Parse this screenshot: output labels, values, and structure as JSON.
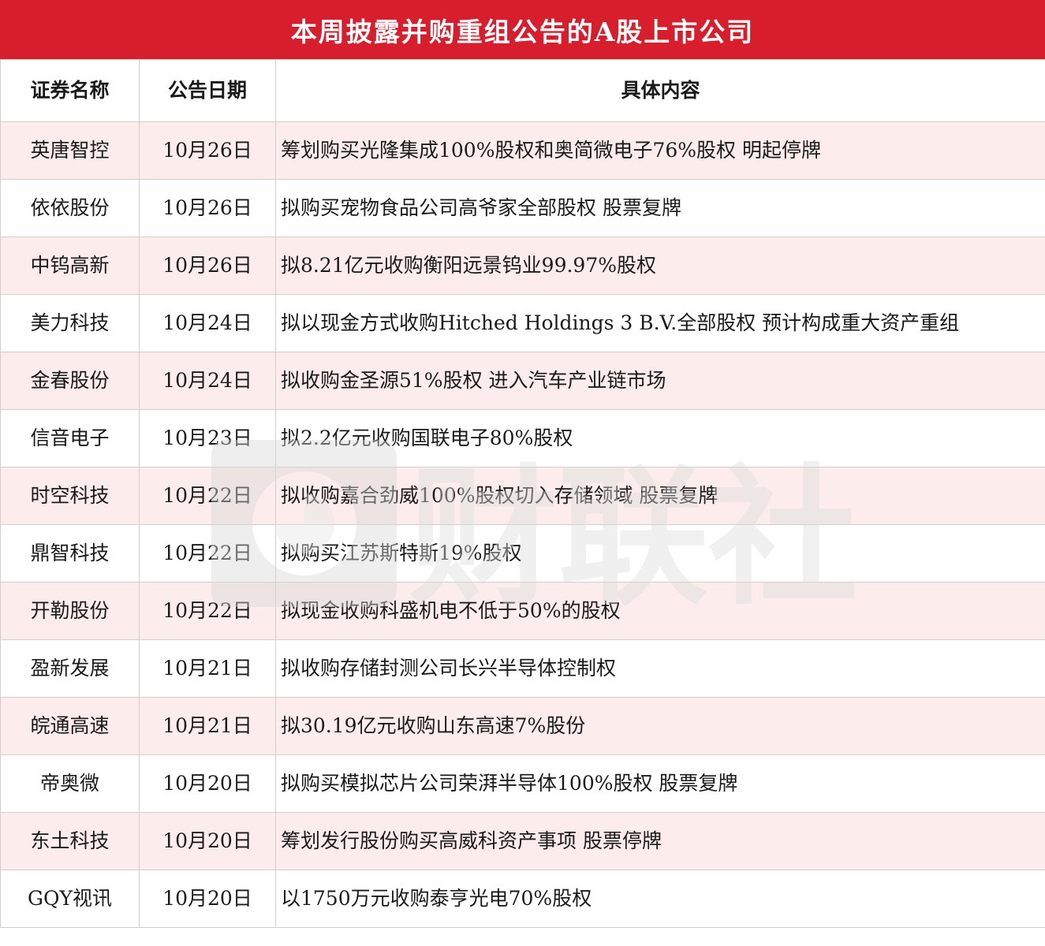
{
  "title": "本周披露并购重组公告的A股上市公司",
  "headers": {
    "name": "证券名称",
    "date": "公告日期",
    "content": "具体内容"
  },
  "rows": [
    {
      "name": "英唐智控",
      "date": "10月26日",
      "content": "筹划购买光隆集成100%股权和奥简微电子76%股权 明起停牌"
    },
    {
      "name": "依依股份",
      "date": "10月26日",
      "content": "拟购买宠物食品公司高爷家全部股权 股票复牌"
    },
    {
      "name": "中钨高新",
      "date": "10月26日",
      "content": "拟8.21亿元收购衡阳远景钨业99.97%股权"
    },
    {
      "name": "美力科技",
      "date": "10月24日",
      "content": "拟以现金方式收购Hitched Holdings 3 B.V.全部股权 预计构成重大资产重组"
    },
    {
      "name": "金春股份",
      "date": "10月24日",
      "content": "拟收购金圣源51%股权 进入汽车产业链市场"
    },
    {
      "name": "信音电子",
      "date": "10月23日",
      "content": "拟2.2亿元收购国联电子80%股权"
    },
    {
      "name": "时空科技",
      "date": "10月22日",
      "content": "拟收购嘉合劲威100%股权切入存储领域 股票复牌"
    },
    {
      "name": "鼎智科技",
      "date": "10月22日",
      "content": "拟购买江苏斯特斯19%股权"
    },
    {
      "name": "开勒股份",
      "date": "10月22日",
      "content": "拟现金收购科盛机电不低于50%的股权"
    },
    {
      "name": "盈新发展",
      "date": "10月21日",
      "content": "拟收购存储封测公司长兴半导体控制权"
    },
    {
      "name": "皖通高速",
      "date": "10月21日",
      "content": "拟30.19亿元收购山东高速7%股份"
    },
    {
      "name": "帝奥微",
      "date": "10月20日",
      "content": "拟购买模拟芯片公司荣湃半导体100%股权 股票复牌"
    },
    {
      "name": "东土科技",
      "date": "10月20日",
      "content": "筹划发行股份购买高威科资产事项 股票停牌"
    },
    {
      "name": "GQY视讯",
      "date": "10月20日",
      "content": "以1750万元收购泰亨光电70%股权"
    }
  ],
  "watermark": {
    "text": "财联社",
    "icon": "cls-logo-icon"
  },
  "colors": {
    "banner": "#d81e2c",
    "alt_row": "#fcecec",
    "border": "#cfcfcf",
    "watermark": "#e6e6e6"
  }
}
